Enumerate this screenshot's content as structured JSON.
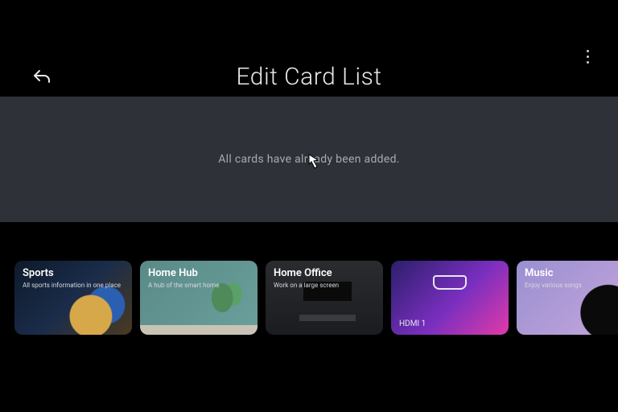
{
  "header": {
    "title": "Edit Card List"
  },
  "status": {
    "message": "All cards have already been added."
  },
  "cards": [
    {
      "title": "Sports",
      "subtitle": "All sports information in one place"
    },
    {
      "title": "Home Hub",
      "subtitle": "A hub of the smart home"
    },
    {
      "title": "Home Office",
      "subtitle": "Work on a large screen"
    },
    {
      "title": "",
      "subtitle": "",
      "bottom_label": "HDMI 1"
    },
    {
      "title": "Music",
      "subtitle": "Enjoy various songs"
    }
  ]
}
